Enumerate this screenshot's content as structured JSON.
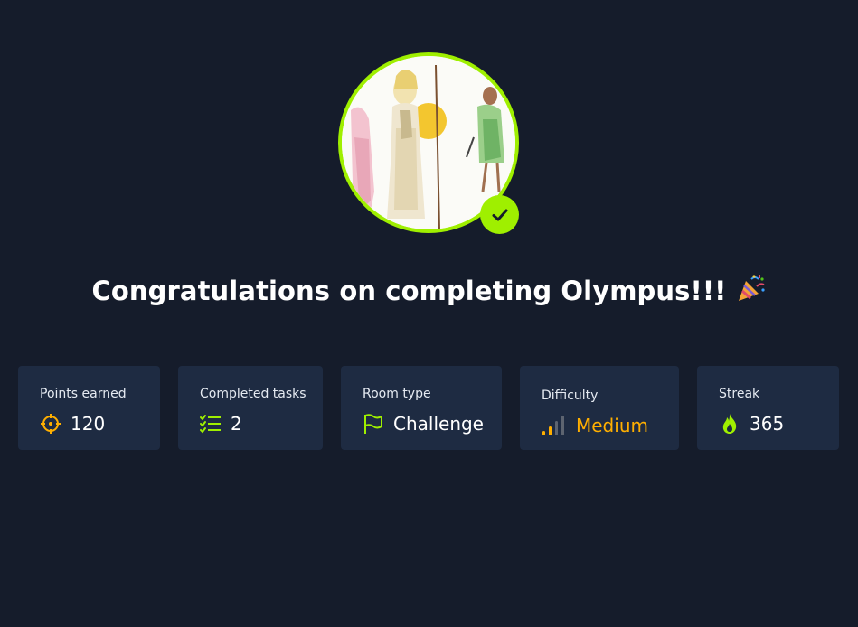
{
  "header": {
    "title": "Congratulations on completing Olympus!!!",
    "title_icon": "party-popper-icon"
  },
  "avatar": {
    "status_icon": "check-icon",
    "ring_color": "#9fef00"
  },
  "stats": [
    {
      "label": "Points earned",
      "value": "120",
      "icon": "crosshair-icon",
      "icon_color": "#ffaf00"
    },
    {
      "label": "Completed tasks",
      "value": "2",
      "icon": "task-list-icon",
      "icon_color": "#9fef00"
    },
    {
      "label": "Room type",
      "value": "Challenge",
      "icon": "flag-icon",
      "icon_color": "#9fef00"
    },
    {
      "label": "Difficulty",
      "value": "Medium",
      "icon": "signal-bars-icon",
      "icon_color": "#ffaf00"
    },
    {
      "label": "Streak",
      "value": "365",
      "icon": "flame-icon",
      "icon_color": "#9fef00"
    }
  ],
  "colors": {
    "background": "#151c2b",
    "card": "#1e2b42",
    "accent_green": "#9fef00",
    "accent_orange": "#ffaf00"
  }
}
